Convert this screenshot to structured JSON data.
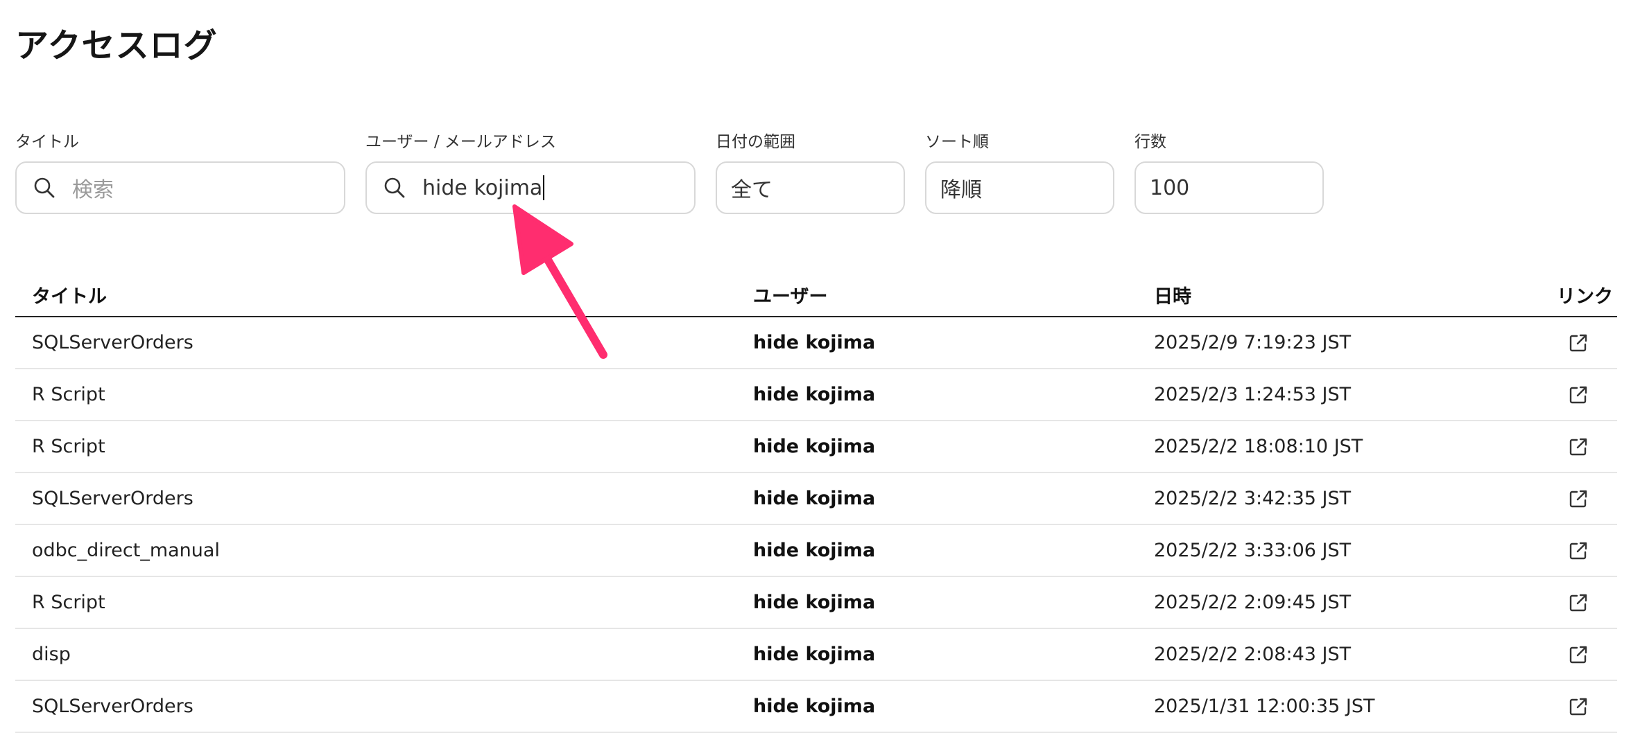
{
  "page": {
    "title": "アクセスログ"
  },
  "filters": {
    "title": {
      "label": "タイトル",
      "placeholder": "検索",
      "value": ""
    },
    "user": {
      "label": "ユーザー / メールアドレス",
      "value": "hide kojima"
    },
    "date_range": {
      "label": "日付の範囲",
      "value": "全て"
    },
    "sort_order": {
      "label": "ソート順",
      "value": "降順"
    },
    "rows": {
      "label": "行数",
      "value": "100"
    }
  },
  "table": {
    "headers": {
      "title": "タイトル",
      "user": "ユーザー",
      "datetime": "日時",
      "link": "リンク"
    },
    "rows": [
      {
        "title": "SQLServerOrders",
        "user": "hide kojima",
        "datetime": "2025/2/9 7:19:23 JST"
      },
      {
        "title": "R Script",
        "user": "hide kojima",
        "datetime": "2025/2/3 1:24:53 JST"
      },
      {
        "title": "R Script",
        "user": "hide kojima",
        "datetime": "2025/2/2 18:08:10 JST"
      },
      {
        "title": "SQLServerOrders",
        "user": "hide kojima",
        "datetime": "2025/2/2 3:42:35 JST"
      },
      {
        "title": "odbc_direct_manual",
        "user": "hide kojima",
        "datetime": "2025/2/2 3:33:06 JST"
      },
      {
        "title": "R Script",
        "user": "hide kojima",
        "datetime": "2025/2/2 2:09:45 JST"
      },
      {
        "title": "disp",
        "user": "hide kojima",
        "datetime": "2025/2/2 2:08:43 JST"
      },
      {
        "title": "SQLServerOrders",
        "user": "hide kojima",
        "datetime": "2025/1/31 12:00:35 JST"
      }
    ]
  },
  "icons": {
    "search": "search-icon",
    "external_link": "external-link-icon",
    "annotation": "pointer-arrow"
  },
  "colors": {
    "annotation_arrow": "#ff2d6f",
    "border": "#d8d8d8",
    "header_rule": "#222222"
  }
}
